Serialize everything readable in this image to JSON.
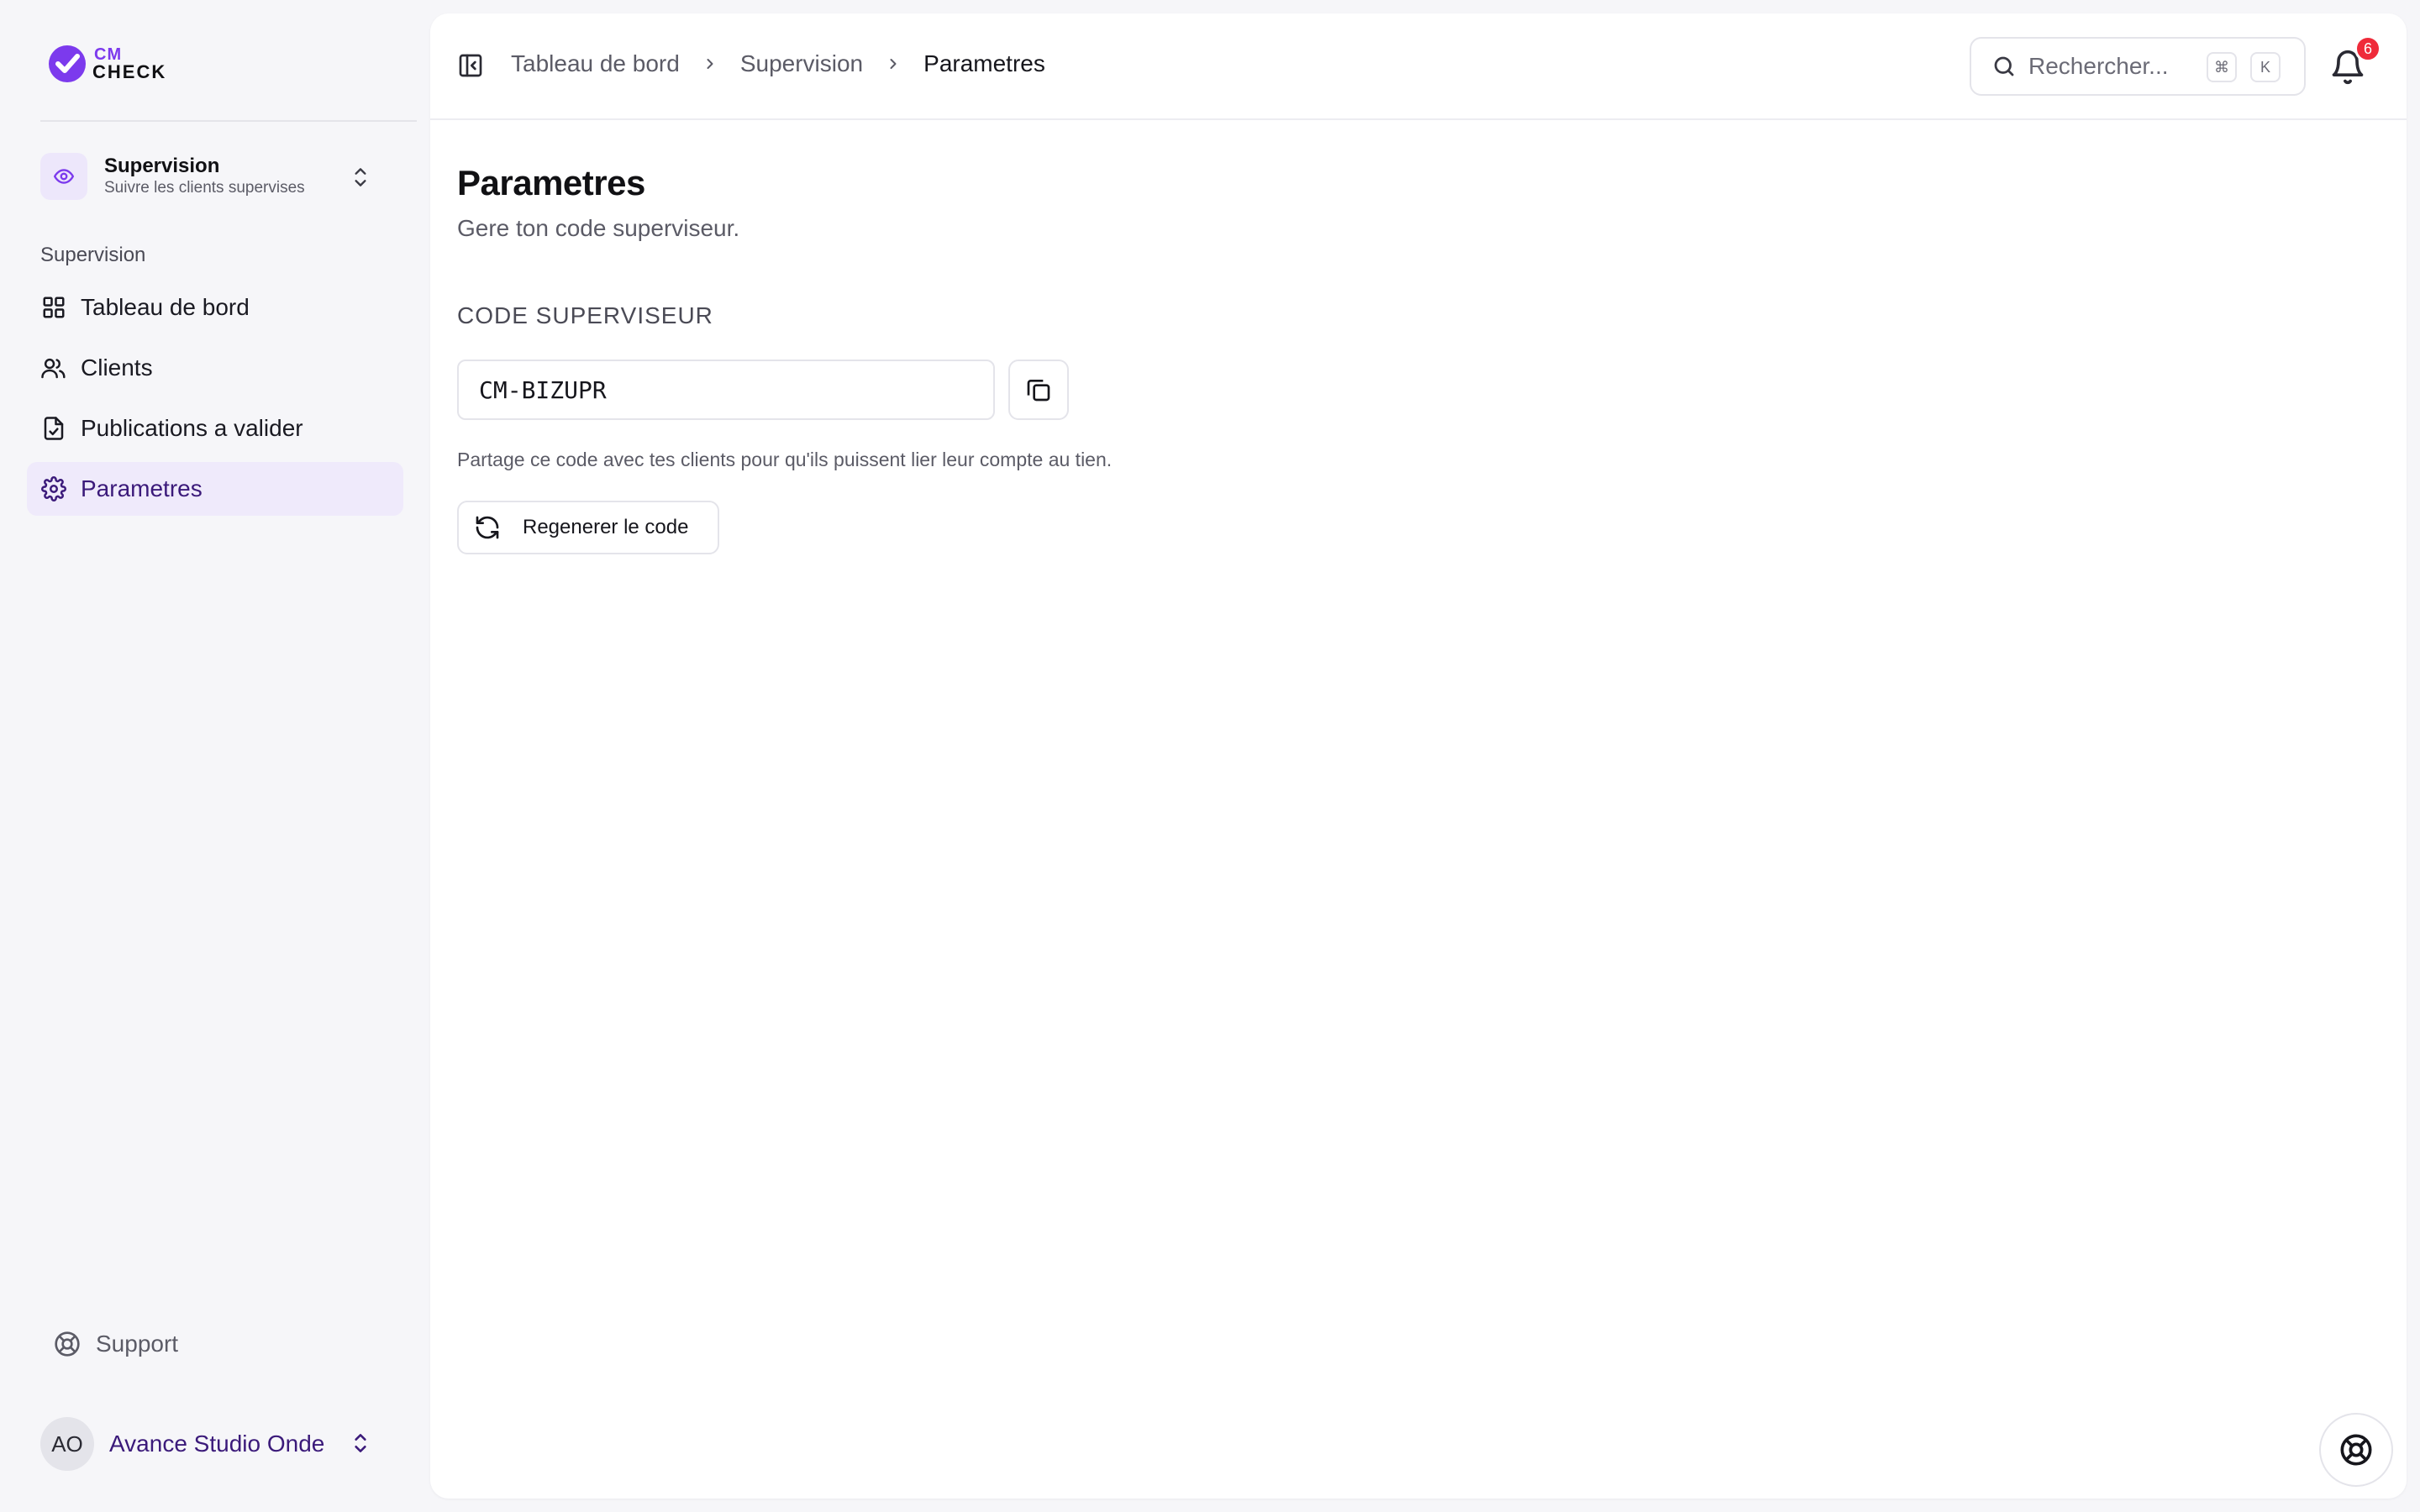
{
  "brand": {
    "line1": "CM",
    "line2": "CHECK",
    "accent": "#7c3aed"
  },
  "workspace": {
    "title": "Supervision",
    "subtitle": "Suivre les clients supervises",
    "icon": "eye-icon"
  },
  "sidebar": {
    "section_label": "Supervision",
    "items": [
      {
        "label": "Tableau de bord",
        "icon": "grid-icon",
        "active": false
      },
      {
        "label": "Clients",
        "icon": "users-icon",
        "active": false
      },
      {
        "label": "Publications a valider",
        "icon": "file-check-icon",
        "active": false
      },
      {
        "label": "Parametres",
        "icon": "gear-icon",
        "active": true
      }
    ],
    "support_label": "Support"
  },
  "user": {
    "initials": "AO",
    "name": "Avance Studio Onde"
  },
  "header": {
    "breadcrumb": [
      "Tableau de bord",
      "Supervision",
      "Parametres"
    ],
    "search_placeholder": "Rechercher...",
    "shortcut": [
      "⌘",
      "K"
    ],
    "notification_count": "6"
  },
  "page": {
    "title": "Parametres",
    "subtitle": "Gere ton code superviseur.",
    "code_label": "CODE SUPERVISEUR",
    "code_value": "CM-BIZUPR",
    "help_text": "Partage ce code avec tes clients pour qu'ils puissent lier leur compte au tien.",
    "regenerate_label": "Regenerer le code"
  },
  "colors": {
    "accent": "#7c3aed",
    "active_bg": "#efeafb",
    "active_text": "#3b1a7a",
    "badge": "#ef2b3a"
  }
}
